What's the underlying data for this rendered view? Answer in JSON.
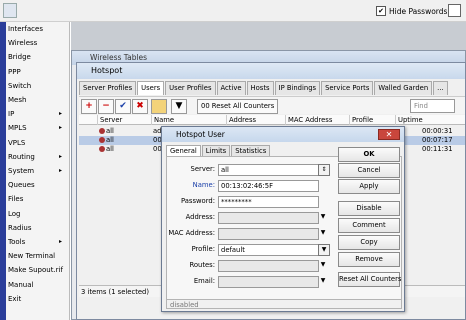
{
  "topbar": {
    "hide_passwords_label": "Hide Passwords",
    "hide_passwords_check": "✔"
  },
  "sidebar": {
    "items": [
      {
        "label": "Interfaces",
        "arrow": ""
      },
      {
        "label": "Wireless",
        "arrow": ""
      },
      {
        "label": "Bridge",
        "arrow": ""
      },
      {
        "label": "PPP",
        "arrow": ""
      },
      {
        "label": "Switch",
        "arrow": ""
      },
      {
        "label": "Mesh",
        "arrow": ""
      },
      {
        "label": "IP",
        "arrow": "▸"
      },
      {
        "label": "MPLS",
        "arrow": "▸"
      },
      {
        "label": "VPLS",
        "arrow": ""
      },
      {
        "label": "Routing",
        "arrow": "▸"
      },
      {
        "label": "System",
        "arrow": "▸"
      },
      {
        "label": "Queues",
        "arrow": ""
      },
      {
        "label": "Files",
        "arrow": ""
      },
      {
        "label": "Log",
        "arrow": ""
      },
      {
        "label": "Radius",
        "arrow": ""
      },
      {
        "label": "Tools",
        "arrow": "▸"
      },
      {
        "label": "New Terminal",
        "arrow": ""
      },
      {
        "label": "Make Supout.rif",
        "arrow": ""
      },
      {
        "label": "Manual",
        "arrow": ""
      },
      {
        "label": "Exit",
        "arrow": ""
      }
    ]
  },
  "wireless_tables": {
    "title": "Wireless Tables"
  },
  "hotspot": {
    "title": "Hotspot",
    "tabs": [
      "Server Profiles",
      "Users",
      "User Profiles",
      "Active",
      "Hosts",
      "IP Bindings",
      "Service Ports",
      "Walled Garden",
      "..."
    ],
    "selected_tab": "Users",
    "toolbar": {
      "reset_all_counters": "00 Reset All Counters",
      "find_placeholder": "Find"
    },
    "columns": [
      "Server",
      "Name",
      "Address",
      "MAC Address",
      "Profile",
      "Uptime"
    ],
    "rows": [
      {
        "server": "all",
        "name": "adi",
        "uptime": "00:00:31"
      },
      {
        "server": "all",
        "name": "00",
        "uptime": "00:07:17"
      },
      {
        "server": "all",
        "name": "00",
        "uptime": "00:11:31"
      }
    ],
    "status": "3 items (1 selected)"
  },
  "dialog": {
    "title": "Hotspot User",
    "close_icon_glyph": "✕",
    "tabs": [
      "General",
      "Limits",
      "Statistics"
    ],
    "fields": {
      "server_label": "Server:",
      "server_value": "all",
      "name_label": "Name:",
      "name_value": "00:13:02:46:5F",
      "password_label": "Password:",
      "password_value": "*********",
      "address_label": "Address:",
      "address_value": "",
      "mac_label": "MAC Address:",
      "mac_value": "",
      "profile_label": "Profile:",
      "profile_value": "default",
      "routes_label": "Routes:",
      "routes_value": "",
      "email_label": "Email:",
      "email_value": ""
    },
    "buttons": [
      "OK",
      "Cancel",
      "Apply",
      "Disable",
      "Comment",
      "Copy",
      "Remove",
      "Reset All Counters"
    ],
    "status": "disabled"
  },
  "colors": {
    "accent_band": "#2a3d9a",
    "selection": "#b9cbe6",
    "close_button": "#c9463c"
  }
}
